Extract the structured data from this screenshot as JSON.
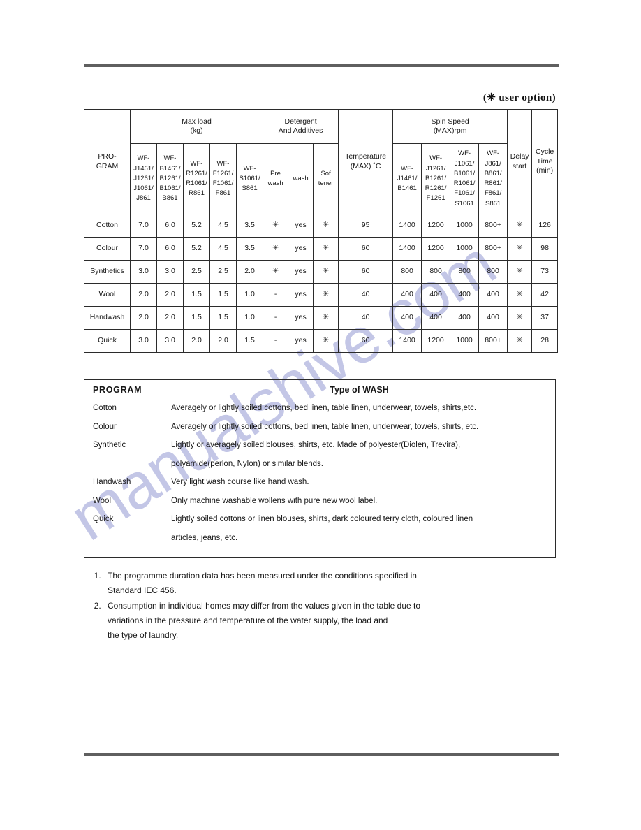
{
  "page": {
    "user_option_note": "(✳ user option)"
  },
  "watermark": {
    "text": "manualshive.com",
    "color": "#b9bde2"
  },
  "spec_table": {
    "group_headers": {
      "program": "PRO-\nGRAM",
      "program_line1": "PRO-",
      "program_line2": "GRAM",
      "max_load_line1": "Max load",
      "max_load_line2": "(kg)",
      "detergent_line1": "Detergent",
      "detergent_line2": "And Additives",
      "temperature_line1": "Temperature",
      "temperature_line2": "(MAX) ˚C",
      "spin_line1": "Spin Speed",
      "spin_line2": "(MAX)rpm",
      "delay_line1": "Delay",
      "delay_line2": "start",
      "cycle_line1": "Cycle",
      "cycle_line2": "Time",
      "cycle_line3": "(min)"
    },
    "max_load_models": [
      "WF-\nJ1461/\nJ1261/\nJ1061/\nJ861",
      "WF-\nB1461/\nB1261/\nB1061/\nB861",
      "WF-\nR1261/\nR1061/\nR861",
      "WF-\nF1261/\nF1061/\nF861",
      "WF-\nS1061/\nS861"
    ],
    "detergent_cols": [
      "Pre\nwash",
      "wash",
      "Sof\ntener"
    ],
    "spin_models": [
      "WF-\nJ1461/\nB1461",
      "WF-\nJ1261/\nB1261/\nR1261/\nF1261",
      "WF-\nJ1061/\nB1061/\nR1061/\nF1061/\nS1061",
      "WF-\nJ861/\nB861/\nR861/\nF861/\nS861"
    ],
    "rows": [
      {
        "program": "Cotton",
        "max_load": [
          "7.0",
          "6.0",
          "5.2",
          "4.5",
          "3.5"
        ],
        "detergent": [
          "✳",
          "yes",
          "✳"
        ],
        "temperature": "95",
        "spin": [
          "1400",
          "1200",
          "1000",
          "800+"
        ],
        "delay_start": "✳",
        "cycle_time": "126"
      },
      {
        "program": "Colour",
        "max_load": [
          "7.0",
          "6.0",
          "5.2",
          "4.5",
          "3.5"
        ],
        "detergent": [
          "✳",
          "yes",
          "✳"
        ],
        "temperature": "60",
        "spin": [
          "1400",
          "1200",
          "1000",
          "800+"
        ],
        "delay_start": "✳",
        "cycle_time": "98"
      },
      {
        "program": "Synthetics",
        "max_load": [
          "3.0",
          "3.0",
          "2.5",
          "2.5",
          "2.0"
        ],
        "detergent": [
          "✳",
          "yes",
          "✳"
        ],
        "temperature": "60",
        "spin": [
          "800",
          "800",
          "800",
          "800"
        ],
        "delay_start": "✳",
        "cycle_time": "73"
      },
      {
        "program": "Wool",
        "max_load": [
          "2.0",
          "2.0",
          "1.5",
          "1.5",
          "1.0"
        ],
        "detergent": [
          "-",
          "yes",
          "✳"
        ],
        "temperature": "40",
        "spin": [
          "400",
          "400",
          "400",
          "400"
        ],
        "delay_start": "✳",
        "cycle_time": "42"
      },
      {
        "program": "Handwash",
        "max_load": [
          "2.0",
          "2.0",
          "1.5",
          "1.5",
          "1.0"
        ],
        "detergent": [
          "-",
          "yes",
          "✳"
        ],
        "temperature": "40",
        "spin": [
          "400",
          "400",
          "400",
          "400"
        ],
        "delay_start": "✳",
        "cycle_time": "37"
      },
      {
        "program": "Quick",
        "max_load": [
          "3.0",
          "3.0",
          "2.0",
          "2.0",
          "1.5"
        ],
        "detergent": [
          "-",
          "yes",
          "✳"
        ],
        "temperature": "60",
        "spin": [
          "1400",
          "1200",
          "1000",
          "800+"
        ],
        "delay_start": "✳",
        "cycle_time": "28"
      }
    ]
  },
  "wash_table": {
    "header_program": "PROGRAM",
    "header_type": "Type of WASH",
    "programs": [
      "Cotton",
      "Colour",
      "Synthetic",
      "",
      "Handwash",
      "Wool",
      "Quick",
      ""
    ],
    "descriptions": [
      "Averagely or lightly soiled cottons, bed linen, table linen, underwear, towels, shirts,etc.",
      "Averagely or lightly soiled cottons, bed linen, table linen, underwear, towels, shirts, etc.",
      "Lightly or averagely soiled blouses, shirts, etc. Made of polyester(Diolen, Trevira),",
      "polyamide(perlon, Nylon) or similar blends.",
      "Very light wash course like hand wash.",
      "Only machine washable wollens with pure new wool label.",
      "Lightly soiled cottons or linen blouses, shirts, dark coloured terry cloth, coloured linen",
      "articles, jeans, etc."
    ]
  },
  "notes": [
    {
      "line1": "The programme duration data has been measured under the conditions specified in",
      "line2": "Standard IEC 456.",
      "line3": ""
    },
    {
      "line1": "Consumption in individual homes may differ from the values given in the table due to",
      "line2": "variations in the pressure and temperature of the water supply, the load and",
      "line3": "the type of laundry."
    }
  ]
}
